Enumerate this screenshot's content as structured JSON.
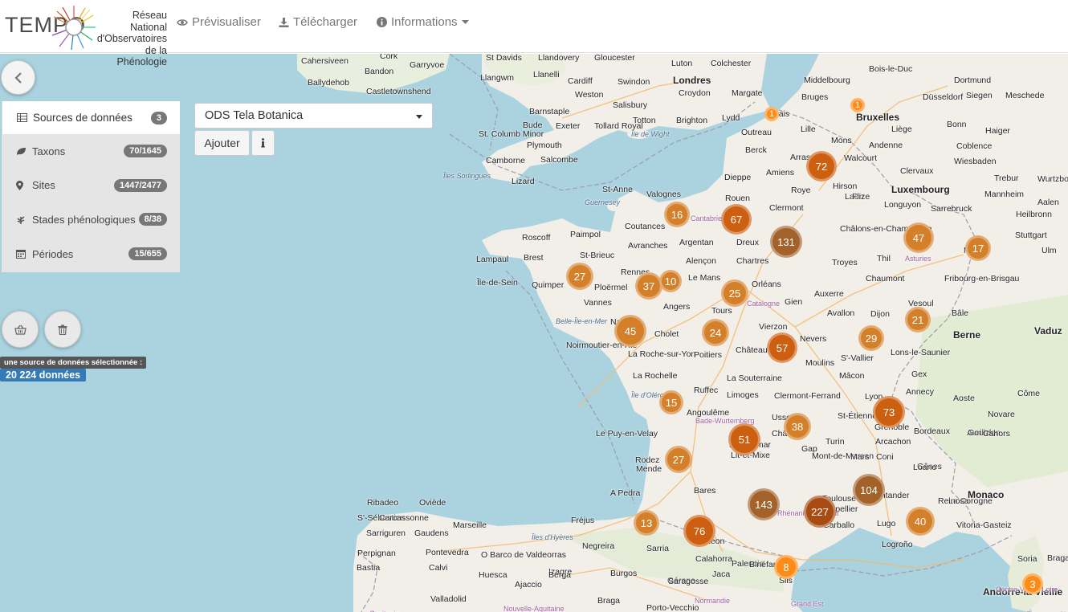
{
  "brand": {
    "logo_word": "TEMPO",
    "subtitle_lines": [
      "Réseau National",
      "d'Observatoires",
      "de la Phénologie"
    ]
  },
  "nav": {
    "preview": "Prévisualiser",
    "download": "Télécharger",
    "info": "Informations"
  },
  "sidebar": {
    "items": [
      {
        "label": "Sources de données",
        "badge": "3",
        "icon": "table-icon"
      },
      {
        "label": "Taxons",
        "badge": "70/1645",
        "icon": "leaf-icon"
      },
      {
        "label": "Sites",
        "badge": "1447/2477",
        "icon": "map-marker-icon"
      },
      {
        "label": "Stades phénologiques",
        "badge": "8/38",
        "icon": "plant-icon"
      },
      {
        "label": "Périodes",
        "badge": "15/655",
        "icon": "calendar-icon"
      }
    ],
    "selection_label": "une source de données sélectionnée :",
    "selection_count": "20 224 données"
  },
  "source_picker": {
    "selected": "ODS Tela Botanica",
    "add_label": "Ajouter"
  },
  "map": {
    "places": [
      {
        "t": "Cahersiveen",
        "c": ""
      },
      {
        "t": "Cork",
        "c": ""
      },
      {
        "t": "Bandon",
        "c": ""
      },
      {
        "t": "Garryvoe",
        "c": ""
      },
      {
        "t": "Ballydehob",
        "c": ""
      },
      {
        "t": "Castletownshend",
        "c": ""
      },
      {
        "t": "St Davids",
        "c": ""
      },
      {
        "t": "Llandovery",
        "c": ""
      },
      {
        "t": "Gloucester",
        "c": ""
      },
      {
        "t": "Luton",
        "c": ""
      },
      {
        "t": "Colchester",
        "c": ""
      },
      {
        "t": "Llangwm",
        "c": ""
      },
      {
        "t": "Llanelli",
        "c": ""
      },
      {
        "t": "Cardiff",
        "c": ""
      },
      {
        "t": "Swindon",
        "c": ""
      },
      {
        "t": "Londres",
        "c": "big"
      },
      {
        "t": "Weston",
        "c": ""
      },
      {
        "t": "Croydon",
        "c": ""
      },
      {
        "t": "Margate",
        "c": ""
      },
      {
        "t": "Barnstaple",
        "c": ""
      },
      {
        "t": "Salisbury",
        "c": ""
      },
      {
        "t": "Bude",
        "c": ""
      },
      {
        "t": "Exeter",
        "c": ""
      },
      {
        "t": "Totton",
        "c": ""
      },
      {
        "t": "Brighton",
        "c": ""
      },
      {
        "t": "Lydd",
        "c": ""
      },
      {
        "t": "Tollard Royal",
        "c": ""
      },
      {
        "t": "St. Columb Minor",
        "c": ""
      },
      {
        "t": "Plymouth",
        "c": ""
      },
      {
        "t": "Île de Wight",
        "c": "sea"
      },
      {
        "t": "Camborne",
        "c": ""
      },
      {
        "t": "Salcombe",
        "c": ""
      },
      {
        "t": "Îles Sorlingues",
        "c": "sea"
      },
      {
        "t": "Lizard",
        "c": ""
      },
      {
        "t": "Middelbourg",
        "c": ""
      },
      {
        "t": "Bois-le-Duc",
        "c": ""
      },
      {
        "t": "Dortmund",
        "c": ""
      },
      {
        "t": "Bruges",
        "c": ""
      },
      {
        "t": "Bruxelles",
        "c": "big"
      },
      {
        "t": "Düsseldorf",
        "c": ""
      },
      {
        "t": "Siegen",
        "c": ""
      },
      {
        "t": "Meschede",
        "c": ""
      },
      {
        "t": "Calais",
        "c": ""
      },
      {
        "t": "Outreau",
        "c": ""
      },
      {
        "t": "Lille",
        "c": ""
      },
      {
        "t": "Mons",
        "c": ""
      },
      {
        "t": "Liège",
        "c": ""
      },
      {
        "t": "Bonn",
        "c": ""
      },
      {
        "t": "Haiger",
        "c": ""
      },
      {
        "t": "Andenne",
        "c": ""
      },
      {
        "t": "Coblence",
        "c": ""
      },
      {
        "t": "Berck",
        "c": ""
      },
      {
        "t": "Arras",
        "c": ""
      },
      {
        "t": "Walcourt",
        "c": ""
      },
      {
        "t": "Wiesbaden",
        "c": ""
      },
      {
        "t": "Clervaux",
        "c": ""
      },
      {
        "t": "Amiens",
        "c": ""
      },
      {
        "t": "Trebur",
        "c": ""
      },
      {
        "t": "Wurtzbourg",
        "c": ""
      },
      {
        "t": "Dieppe",
        "c": ""
      },
      {
        "t": "Hirson",
        "c": ""
      },
      {
        "t": "Luxembourg",
        "c": "big"
      },
      {
        "t": "Mannheim",
        "c": ""
      },
      {
        "t": "Roye",
        "c": ""
      },
      {
        "t": "Laon",
        "c": ""
      },
      {
        "t": "Flize",
        "c": ""
      },
      {
        "t": "Aalen",
        "c": ""
      },
      {
        "t": "St-Anne",
        "c": ""
      },
      {
        "t": "Valognes",
        "c": ""
      },
      {
        "t": "Rouen",
        "c": ""
      },
      {
        "t": "Longuyon",
        "c": ""
      },
      {
        "t": "Sarrebruck",
        "c": ""
      },
      {
        "t": "Heilbronn",
        "c": ""
      },
      {
        "t": "Guernesey",
        "c": "sea"
      },
      {
        "t": "Clermont",
        "c": ""
      },
      {
        "t": "Coutances",
        "c": ""
      },
      {
        "t": "Châlons-en-Champagne",
        "c": ""
      },
      {
        "t": "Stuttgart",
        "c": ""
      },
      {
        "t": "Roscoff",
        "c": ""
      },
      {
        "t": "Paimpol",
        "c": ""
      },
      {
        "t": "Argentan",
        "c": ""
      },
      {
        "t": "Dreux",
        "c": ""
      },
      {
        "t": "Avranches",
        "c": ""
      },
      {
        "t": "Metz",
        "c": ""
      },
      {
        "t": "Ulm",
        "c": ""
      },
      {
        "t": "Lampaul",
        "c": ""
      },
      {
        "t": "Brest",
        "c": ""
      },
      {
        "t": "St-Brieuc",
        "c": ""
      },
      {
        "t": "Alençon",
        "c": ""
      },
      {
        "t": "Chartres",
        "c": ""
      },
      {
        "t": "Troyes",
        "c": ""
      },
      {
        "t": "Thil",
        "c": ""
      },
      {
        "t": "Fribourg-en-Brisgau",
        "c": ""
      },
      {
        "t": "Île-de-Sein",
        "c": ""
      },
      {
        "t": "Quimper",
        "c": ""
      },
      {
        "t": "Rennes",
        "c": ""
      },
      {
        "t": "Le Mans",
        "c": ""
      },
      {
        "t": "Orléans",
        "c": ""
      },
      {
        "t": "Gien",
        "c": ""
      },
      {
        "t": "Chaumont",
        "c": ""
      },
      {
        "t": "Ploërmel",
        "c": ""
      },
      {
        "t": "Vannes",
        "c": ""
      },
      {
        "t": "Angers",
        "c": ""
      },
      {
        "t": "Tours",
        "c": ""
      },
      {
        "t": "Auxerre",
        "c": ""
      },
      {
        "t": "Dijon",
        "c": ""
      },
      {
        "t": "Vesoul",
        "c": ""
      },
      {
        "t": "Bâle",
        "c": ""
      },
      {
        "t": "Belle-Île-en-Mer",
        "c": "sea"
      },
      {
        "t": "Nantes",
        "c": ""
      },
      {
        "t": "Vierzon",
        "c": ""
      },
      {
        "t": "Avallon",
        "c": ""
      },
      {
        "t": "Berne",
        "c": "big"
      },
      {
        "t": "Vaduz",
        "c": "big"
      },
      {
        "t": "Cholet",
        "c": ""
      },
      {
        "t": "Noirmoutier-en-l'Île",
        "c": ""
      },
      {
        "t": "La Roche-sur-Yon",
        "c": ""
      },
      {
        "t": "Poitiers",
        "c": ""
      },
      {
        "t": "Châteauroux",
        "c": ""
      },
      {
        "t": "Nevers",
        "c": ""
      },
      {
        "t": "S'-Vallier",
        "c": ""
      },
      {
        "t": "Lons-le-Saunier",
        "c": ""
      },
      {
        "t": "Moulins",
        "c": ""
      },
      {
        "t": "La Rochelle",
        "c": ""
      },
      {
        "t": "La Souterraine",
        "c": ""
      },
      {
        "t": "Mâcon",
        "c": ""
      },
      {
        "t": "Gex",
        "c": ""
      },
      {
        "t": "Annecy",
        "c": ""
      },
      {
        "t": "Aoste",
        "c": ""
      },
      {
        "t": "Côme",
        "c": ""
      },
      {
        "t": "Île d'Oléron",
        "c": "sea"
      },
      {
        "t": "Ruffec",
        "c": ""
      },
      {
        "t": "Limoges",
        "c": ""
      },
      {
        "t": "Clermont-Ferrand",
        "c": ""
      },
      {
        "t": "Lyon",
        "c": ""
      },
      {
        "t": "Angoulême",
        "c": ""
      },
      {
        "t": "St-Étienne",
        "c": ""
      },
      {
        "t": "Novare",
        "c": ""
      },
      {
        "t": "Ussel",
        "c": ""
      },
      {
        "t": "Grenoble",
        "c": ""
      },
      {
        "t": "Bordeaux",
        "c": ""
      },
      {
        "t": "Aurillac",
        "c": ""
      },
      {
        "t": "Le Puy-en-Velay",
        "c": ""
      },
      {
        "t": "Châtulus",
        "c": ""
      },
      {
        "t": "Turin",
        "c": ""
      },
      {
        "t": "Arcachon",
        "c": ""
      },
      {
        "t": "Gourdon",
        "c": ""
      },
      {
        "t": "Mende",
        "c": ""
      },
      {
        "t": "Montélimar",
        "c": ""
      },
      {
        "t": "Gap",
        "c": ""
      },
      {
        "t": "Coni",
        "c": ""
      },
      {
        "t": "Gênes",
        "c": ""
      },
      {
        "t": "Cahors",
        "c": ""
      },
      {
        "t": "Rodez",
        "c": ""
      },
      {
        "t": "Lit-et-Mixe",
        "c": ""
      },
      {
        "t": "Mont-de-Marsan",
        "c": ""
      },
      {
        "t": "Mars",
        "c": ""
      },
      {
        "t": "Loano",
        "c": ""
      },
      {
        "t": "Monaco",
        "c": "big"
      },
      {
        "t": "A Pedra",
        "c": ""
      },
      {
        "t": "Bares",
        "c": ""
      },
      {
        "t": "Toulouse",
        "c": ""
      },
      {
        "t": "Montpellier",
        "c": ""
      },
      {
        "t": "La Corogne",
        "c": ""
      },
      {
        "t": "Ribadeo",
        "c": ""
      },
      {
        "t": "Oviède",
        "c": ""
      },
      {
        "t": "Santander",
        "c": ""
      },
      {
        "t": "S'-Sébastien",
        "c": ""
      },
      {
        "t": "Carcassonne",
        "c": ""
      },
      {
        "t": "Marseille",
        "c": ""
      },
      {
        "t": "Fréjus",
        "c": ""
      },
      {
        "t": "Carballo",
        "c": ""
      },
      {
        "t": "Lugo",
        "c": ""
      },
      {
        "t": "Reinosa",
        "c": ""
      },
      {
        "t": "Vitoria-Gasteiz",
        "c": ""
      },
      {
        "t": "Sarriguren",
        "c": ""
      },
      {
        "t": "Gaudens",
        "c": ""
      },
      {
        "t": "Îles d'Hyères",
        "c": "sea"
      },
      {
        "t": "Negreira",
        "c": ""
      },
      {
        "t": "Sarria",
        "c": ""
      },
      {
        "t": "Léon",
        "c": ""
      },
      {
        "t": "Logroño",
        "c": ""
      },
      {
        "t": "Perpignan",
        "c": ""
      },
      {
        "t": "Pontevedra",
        "c": ""
      },
      {
        "t": "O Barco de Valdeorras",
        "c": ""
      },
      {
        "t": "Izagre",
        "c": ""
      },
      {
        "t": "Burgos",
        "c": ""
      },
      {
        "t": "Calahorra",
        "c": ""
      },
      {
        "t": "Jaca",
        "c": ""
      },
      {
        "t": "Andorre-la-Vieille",
        "c": "big"
      },
      {
        "t": "Bastia",
        "c": ""
      },
      {
        "t": "Calvi",
        "c": ""
      },
      {
        "t": "Huesca",
        "c": ""
      },
      {
        "t": "Berga",
        "c": ""
      },
      {
        "t": "Gérone",
        "c": ""
      },
      {
        "t": "Palencia",
        "c": ""
      },
      {
        "t": "Bragance",
        "c": ""
      },
      {
        "t": "Soria",
        "c": ""
      },
      {
        "t": "Saragosse",
        "c": ""
      },
      {
        "t": "Binéfar",
        "c": ""
      },
      {
        "t": "Sils",
        "c": ""
      },
      {
        "t": "Ajaccio",
        "c": ""
      },
      {
        "t": "Valladolid",
        "c": ""
      },
      {
        "t": "Braga",
        "c": ""
      },
      {
        "t": "Porto-Vecchio",
        "c": ""
      },
      {
        "t": "Normandie",
        "c": "region"
      },
      {
        "t": "Grand Est",
        "c": "region"
      },
      {
        "t": "Centre-Val de Loire",
        "c": "region"
      },
      {
        "t": "Nouvelle-Aquitaine",
        "c": "region"
      },
      {
        "t": "Occitanie",
        "c": "region"
      },
      {
        "t": "Provence-Alpes-Côte d'Azur",
        "c": "region"
      },
      {
        "t": "Cantabrie",
        "c": "region"
      },
      {
        "t": "Asturies",
        "c": "region"
      },
      {
        "t": "Catalogne",
        "c": "region"
      },
      {
        "t": "Bade-Wurtemberg",
        "c": "region"
      },
      {
        "t": "Rhénanie-Palatinat",
        "c": "region"
      }
    ],
    "clusters": [
      {
        "n": "1",
        "tone": "orange"
      },
      {
        "n": "1",
        "tone": "orange"
      },
      {
        "n": "72",
        "tone": "dark"
      },
      {
        "n": "16",
        "tone": "light"
      },
      {
        "n": "67",
        "tone": "dark"
      },
      {
        "n": "131",
        "tone": "brown"
      },
      {
        "n": "47",
        "tone": "light"
      },
      {
        "n": "17",
        "tone": "light"
      },
      {
        "n": "27",
        "tone": "light"
      },
      {
        "n": "37",
        "tone": "light"
      },
      {
        "n": "10",
        "tone": "light"
      },
      {
        "n": "25",
        "tone": "light"
      },
      {
        "n": "45",
        "tone": "light"
      },
      {
        "n": "24",
        "tone": "light"
      },
      {
        "n": "57",
        "tone": "dark"
      },
      {
        "n": "29",
        "tone": "light"
      },
      {
        "n": "21",
        "tone": "light"
      },
      {
        "n": "15",
        "tone": "light"
      },
      {
        "n": "73",
        "tone": "dark"
      },
      {
        "n": "38",
        "tone": "light"
      },
      {
        "n": "51",
        "tone": "dark"
      },
      {
        "n": "27",
        "tone": "light"
      },
      {
        "n": "104",
        "tone": "brown"
      },
      {
        "n": "143",
        "tone": "brown"
      },
      {
        "n": "227",
        "tone": "deep"
      },
      {
        "n": "40",
        "tone": "light"
      },
      {
        "n": "13",
        "tone": "light"
      },
      {
        "n": "76",
        "tone": "dark"
      },
      {
        "n": "8",
        "tone": "orange"
      },
      {
        "n": "3",
        "tone": "orange"
      }
    ]
  },
  "colors": {
    "orange": "#fd8c17",
    "light": "#d4802b",
    "dark": "#cc5f10",
    "brown": "#a3622a",
    "deep": "#a74b12"
  }
}
